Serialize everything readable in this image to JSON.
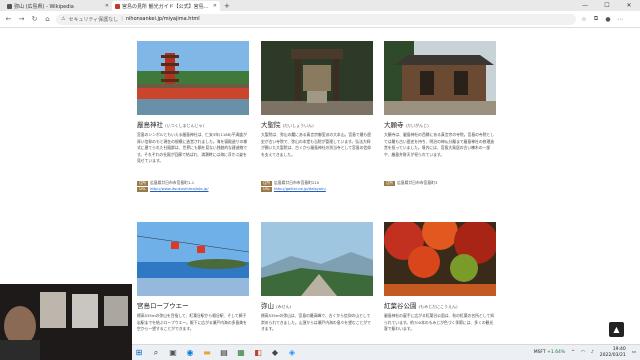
{
  "browser": {
    "tabs": [
      {
        "title": "弥山 (広島県) - Wikipedia",
        "favicon_color": "#555555",
        "active": false
      },
      {
        "title": "宮島の見所 観光ガイド【公式】宮島観光協会",
        "favicon_color": "#c0392b",
        "active": true
      }
    ],
    "new_tab": "+",
    "security_label": "セキュリティ保護なし",
    "url": "nihonsankei.jp/miyajima.html"
  },
  "cards": [
    {
      "name": "嚴島神社",
      "reading": "(いつくしまじんじゃ)",
      "description": "宮島のシンボルともいえる嚴島神社は、仁安3年(1168)平清盛が厚い信仰のもと現在の規模に造営されました。海を寝殿造りの様式に建てられた社殿群は、世界にも類を見ない独創的な建造物です。それぞれの社殿が回廊で結ばれ、満潮時には海に浮かぶ姿を見せています。",
      "meta": [
        {
          "badge": "住所",
          "text": "広島県廿日市市宮島町1-1"
        },
        {
          "badge": "URL",
          "text": "http://www.itsukushimajinja.jp/",
          "is_link": true
        }
      ]
    },
    {
      "name": "大聖院",
      "reading": "(だいしょういん)",
      "description": "大聖院は、弥山の麓にある真言宗御室派の大本山。宮島で最も歴史が古い寺院で、弥山の本堂も当院が管理しています。弘法大師が開いた大聖院は、古くから嚴島神社の別当寺として宮島の信仰を支えてきました。",
      "meta": [
        {
          "badge": "住所",
          "text": "広島県廿日市市宮島町210"
        },
        {
          "badge": "URL",
          "text": "http://galilei.ne.jp/daisyoin/",
          "is_link": true
        }
      ]
    },
    {
      "name": "大願寺",
      "reading": "(だいがんじ)",
      "description": "大願寺は、嚴島神社の西隣にある真言宗の寺院。宮島の寺院としては最も古い歴史を持ち、明治の神仏分離まで嚴島神社の修理造営を担っていました。境内には、宮島大鳥居の古い棟木の一部や、厳島弁財天が祀られています。",
      "meta": [
        {
          "badge": "住所",
          "text": "広島県廿日市市宮島町3"
        }
      ]
    },
    {
      "name": "宮島ロープウエー",
      "reading": "",
      "description": "標高535mの弥山を目指して、紅葉谷駅から榧谷駅、そして獅子岩駅までを結ぶロープウエー。眼下に広がる瀬戸内海の多島美を空から一望することができます。"
    },
    {
      "name": "弥山",
      "reading": "(みせん)",
      "description": "標高535mの弥山は、宮島の最高峰で、古くから信仰の山として崇められてきました。山頂からは瀬戸内海の島々を望むことができます。"
    },
    {
      "name": "紅葉谷公園",
      "reading": "(もみじだにこうえん)",
      "description": "嚴島神社の裏手に広がる紅葉谷公園は、秋の紅葉の名所として知られています。約700本のもみじが色づく季節には、多くの観光客で賑わいます。"
    }
  ],
  "scroll_top": "▲",
  "taskbar": {
    "stock_name": "MSFT",
    "stock_change": "+1.64%",
    "time": "19:40",
    "date": "2022/03/21"
  }
}
